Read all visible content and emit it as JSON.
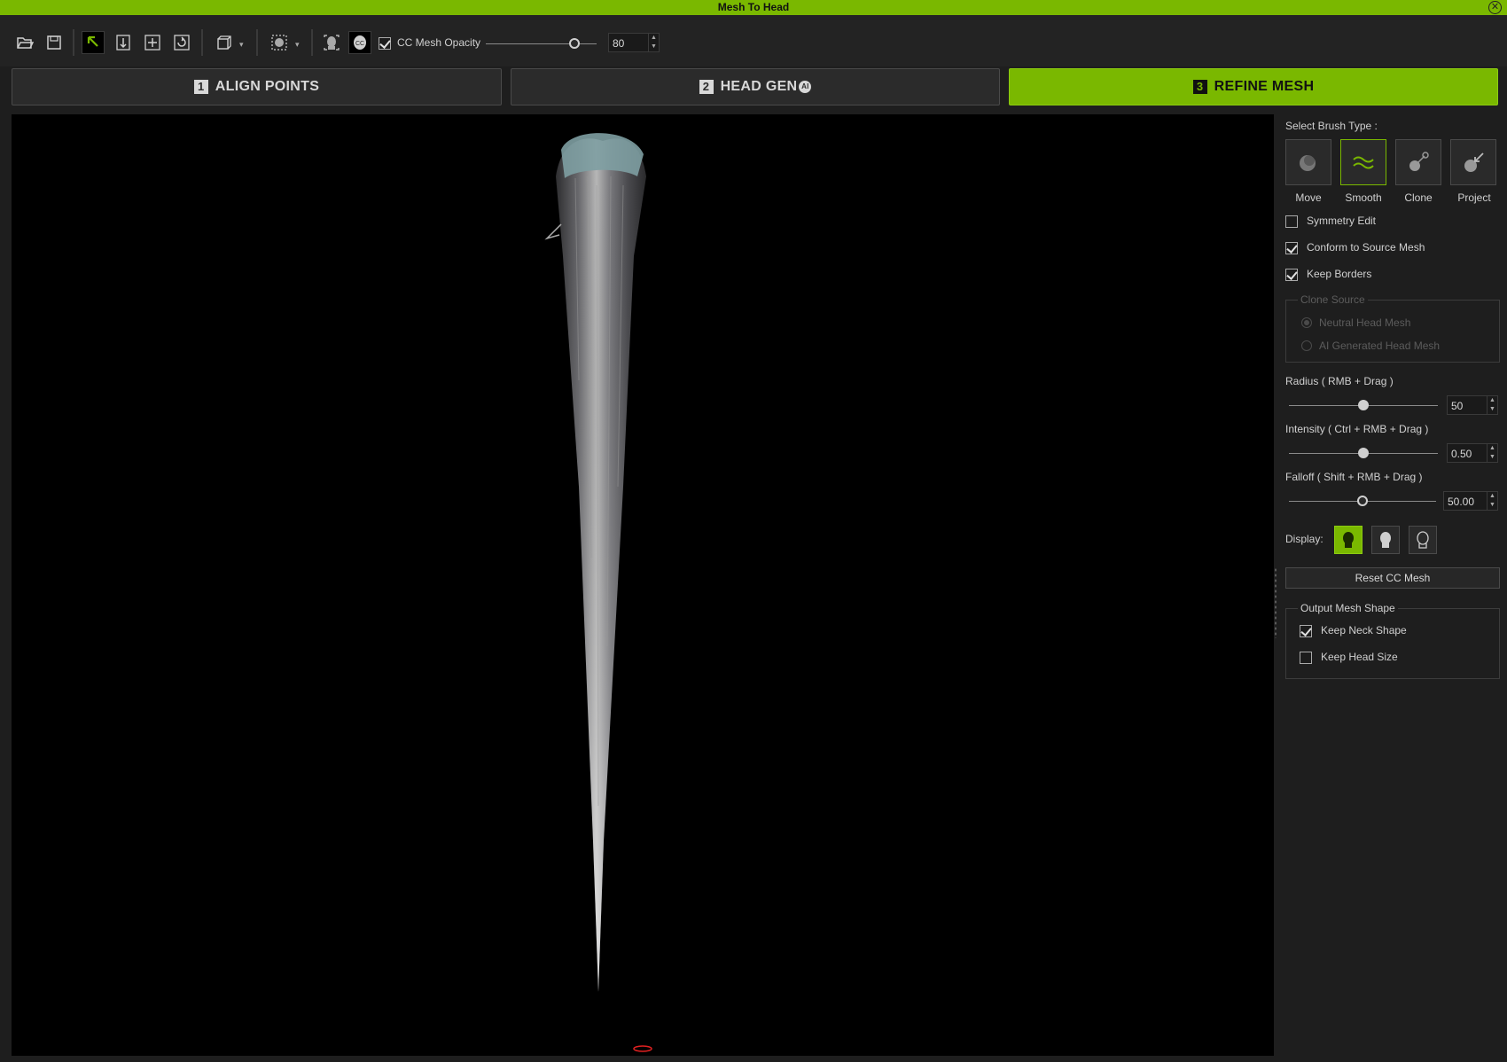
{
  "window": {
    "title": "Mesh To Head",
    "close_glyph": "✕"
  },
  "toolbar": {
    "icons": [
      "open-folder-icon",
      "save-icon",
      "select-arrow-icon",
      "move-vertical-icon",
      "move-all-icon",
      "rotate-icon",
      "view-cube-icon",
      "display-mode-icon",
      "head-mesh-icon",
      "cc-head-icon"
    ],
    "cc_mesh_opacity": {
      "checked": true,
      "label": "CC Mesh Opacity",
      "value": "80",
      "fraction": 0.8
    }
  },
  "steps": [
    {
      "num": "1",
      "label": "ALIGN POINTS",
      "active": false
    },
    {
      "num": "2",
      "label": "HEAD GEN",
      "badge": "AI",
      "active": false
    },
    {
      "num": "3",
      "label": "REFINE MESH",
      "active": true
    }
  ],
  "panel": {
    "brush_title": "Select Brush Type :",
    "brushes": [
      {
        "name": "Move",
        "icon": "move-brush-icon",
        "active": false
      },
      {
        "name": "Smooth",
        "icon": "smooth-brush-icon",
        "active": true
      },
      {
        "name": "Clone",
        "icon": "clone-brush-icon",
        "active": false
      },
      {
        "name": "Project",
        "icon": "project-brush-icon",
        "active": false
      }
    ],
    "options": [
      {
        "label": "Symmetry Edit",
        "checked": false
      },
      {
        "label": "Conform to Source Mesh",
        "checked": true
      },
      {
        "label": "Keep Borders",
        "checked": true
      }
    ],
    "clone_source": {
      "title": "Clone Source",
      "options": [
        {
          "label": "Neutral Head Mesh",
          "selected": true
        },
        {
          "label": "AI Generated Head Mesh",
          "selected": false
        }
      ]
    },
    "radius": {
      "label": "Radius ( RMB + Drag )",
      "value": "50",
      "fraction": 0.5
    },
    "intensity": {
      "label": "Intensity ( Ctrl + RMB + Drag )",
      "value": "0.50",
      "fraction": 0.5
    },
    "falloff": {
      "label": "Falloff ( Shift + RMB + Drag )",
      "value": "50.00",
      "fraction": 0.5
    },
    "display": {
      "label": "Display:",
      "modes": [
        {
          "icon": "head-solid-icon",
          "active": true
        },
        {
          "icon": "head-shaded-icon",
          "active": false
        },
        {
          "icon": "head-outline-icon",
          "active": false
        }
      ]
    },
    "reset_label": "Reset CC Mesh",
    "output": {
      "title": "Output Mesh Shape",
      "options": [
        {
          "label": "Keep Neck Shape",
          "checked": true
        },
        {
          "label": "Keep Head Size",
          "checked": false
        }
      ]
    }
  },
  "colors": {
    "accent": "#7ab800",
    "background": "#1e1e1e",
    "viewport": "#000000"
  }
}
